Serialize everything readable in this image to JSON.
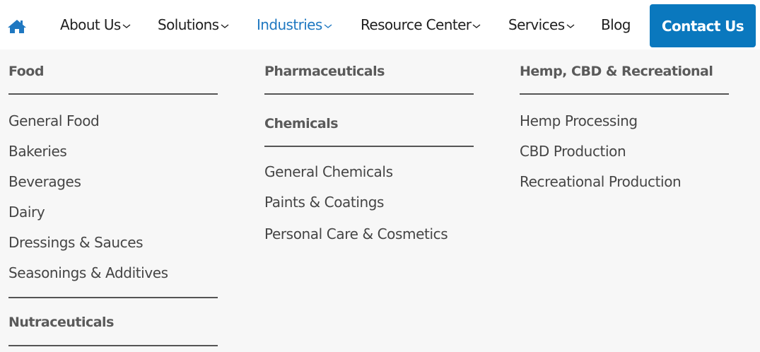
{
  "nav": {
    "home_icon": "home-icon",
    "items": [
      {
        "label": "About Us",
        "dropdown": true
      },
      {
        "label": "Solutions",
        "dropdown": true
      },
      {
        "label": "Industries",
        "dropdown": true,
        "active": true
      },
      {
        "label": "Resource Center",
        "dropdown": true
      },
      {
        "label": "Services",
        "dropdown": true
      },
      {
        "label": "Blog",
        "dropdown": false
      }
    ],
    "contact_label": "Contact Us"
  },
  "menu": {
    "col1": {
      "heading": "Food",
      "links": [
        "General Food",
        "Bakeries",
        "Beverages",
        "Dairy",
        "Dressings & Sauces",
        "Seasonings & Additives"
      ],
      "heading2": "Nutraceuticals"
    },
    "col2": {
      "heading": "Pharmaceuticals",
      "heading2": "Chemicals",
      "links": [
        "General Chemicals",
        "Paints & Coatings",
        "Personal Care & Cosmetics"
      ]
    },
    "col3": {
      "heading": "Hemp, CBD & Recreational",
      "links": [
        "Hemp Processing",
        "CBD Production",
        "Recreational Production"
      ]
    }
  },
  "colors": {
    "accent": "#1f78c1",
    "button": "#0a78be",
    "panel_bg": "#f7f7f7",
    "text": "#1f1f1f"
  }
}
